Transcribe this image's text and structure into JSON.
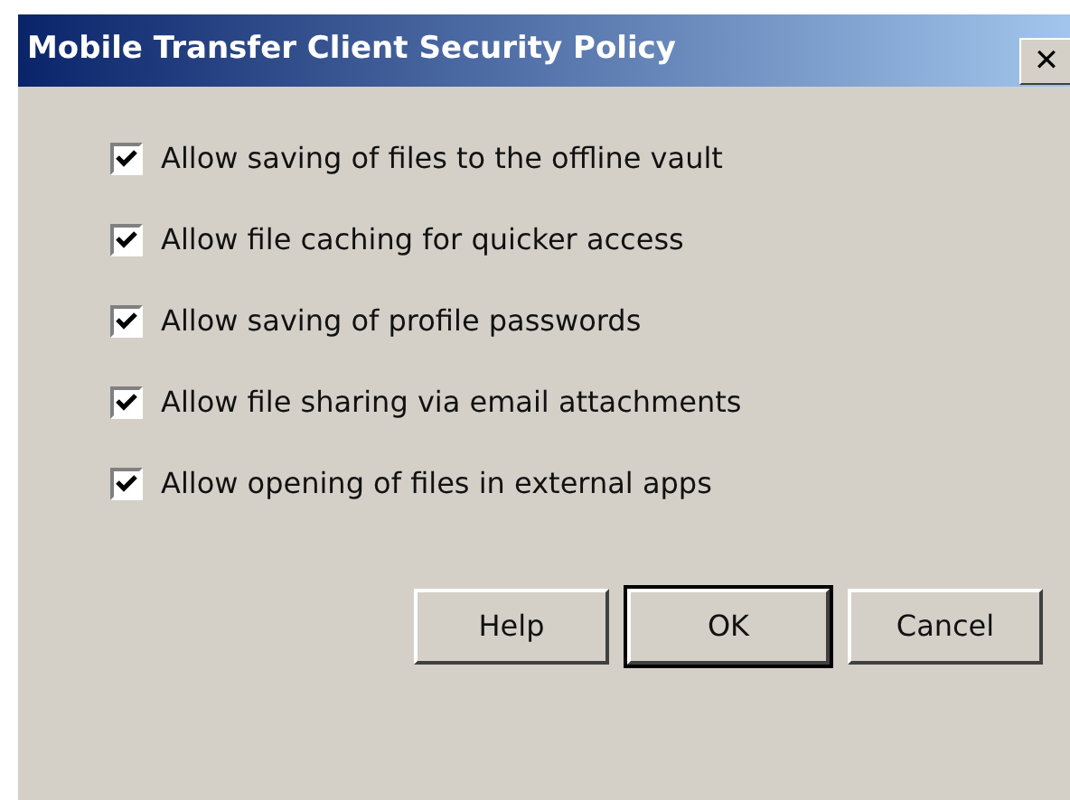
{
  "window": {
    "title": "Mobile Transfer Client Security Policy",
    "close": "✕"
  },
  "options": [
    {
      "label": "Allow saving of files to the offline vault",
      "checked": true
    },
    {
      "label": "Allow file caching for quicker access",
      "checked": true
    },
    {
      "label": "Allow saving of profile passwords",
      "checked": true
    },
    {
      "label": "Allow file sharing via email attachments",
      "checked": true
    },
    {
      "label": "Allow opening of files in external apps",
      "checked": true
    }
  ],
  "buttons": [
    {
      "label": "Help",
      "default": false
    },
    {
      "label": "OK",
      "default": true
    },
    {
      "label": "Cancel",
      "default": false
    }
  ]
}
